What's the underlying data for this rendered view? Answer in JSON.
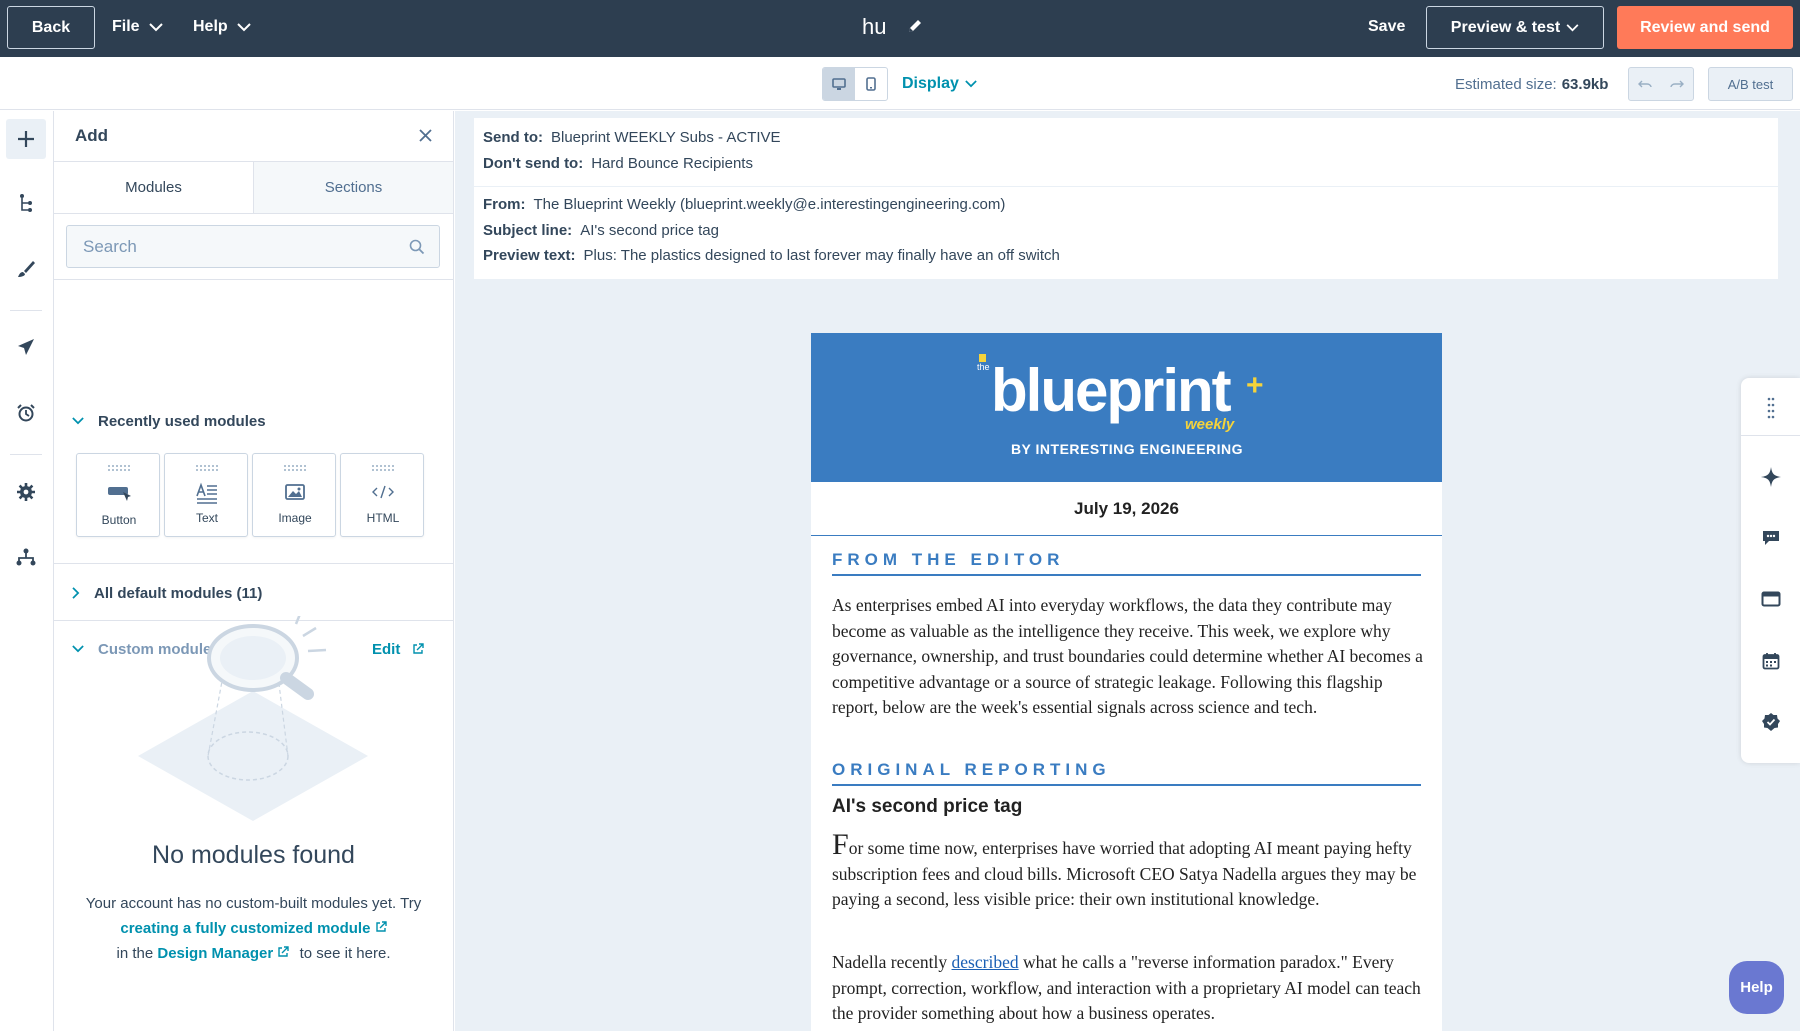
{
  "topbar": {
    "back_label": "Back",
    "file_label": "File",
    "help_label": "Help",
    "title": "hu",
    "save_label": "Save",
    "preview_label": "Preview & test",
    "review_label": "Review and send"
  },
  "toolbar": {
    "display_label": "Display",
    "estimated_size_label": "Estimated size:",
    "estimated_size_value": "63.9kb",
    "ab_test_label": "A/B test"
  },
  "panel": {
    "title": "Add",
    "tabs": [
      "Modules",
      "Sections"
    ],
    "search_placeholder": "Search",
    "recently_used_label": "Recently used modules",
    "modules": [
      {
        "label": "Button",
        "icon": "button-icon"
      },
      {
        "label": "Text",
        "icon": "text-icon"
      },
      {
        "label": "Image",
        "icon": "image-icon"
      },
      {
        "label": "HTML",
        "icon": "code-icon"
      }
    ],
    "all_default_label": "All default modules (11)",
    "custom_label": "Custom modules (0)",
    "edit_label": "Edit",
    "empty_title": "No modules found",
    "empty_text_1": "Your account has no custom-built modules yet. Try",
    "empty_link_1": "creating a fully customized module",
    "empty_text_2": "in the",
    "empty_link_2": "Design Manager",
    "empty_text_3": "to see it here."
  },
  "meta": {
    "send_to_label": "Send to:",
    "send_to_value": "Blueprint WEEKLY Subs - ACTIVE",
    "dont_send_label": "Don't send to:",
    "dont_send_value": "Hard Bounce Recipients",
    "from_label": "From:",
    "from_value": "The Blueprint Weekly (blueprint.weekly@e.interestingengineering.com)",
    "subject_label": "Subject line:",
    "subject_value": "AI's second price tag",
    "preview_text_label": "Preview text:",
    "preview_text_value": "Plus: The plastics designed to last forever may finally have an off switch"
  },
  "email": {
    "logo_small": "the",
    "logo_main": "blueprint",
    "logo_plus": "+",
    "logo_weekly": "weekly",
    "logo_byline": "BY INTERESTING ENGINEERING",
    "date": "July 19, 2026",
    "section_editor": "FROM THE EDITOR",
    "editor_text": "As enterprises embed AI into everyday workflows, the data they contribute may become as valuable as the intelligence they receive. This week, we explore why governance, ownership, and trust boundaries could determine whether AI becomes a competitive advantage or a source of strategic leakage. Following this flagship report, below are the week's essential signals across science and tech.",
    "section_reporting": "ORIGINAL REPORTING",
    "story_title": "AI's second price tag",
    "story_dropcap": "F",
    "story_p1": "or some time now, enterprises have worried that adopting AI meant paying hefty subscription fees and cloud bills. Microsoft CEO Satya Nadella argues they may be paying a second, less visible price: their own institutional knowledge.",
    "story_p2_a": "Nadella recently",
    "story_p2_link": "described",
    "story_p2_b": "what he calls a \"reverse information paradox.\" Every prompt, correction, workflow, and interaction with a proprietary AI model can teach the provider something about how a business operates."
  },
  "help_fab_label": "Help",
  "colors": {
    "topbar": "#2d3e50",
    "accent": "#ff7a59",
    "link": "#0091ae",
    "email_blue": "#3a7cc1",
    "logo_yellow": "#f5d33b"
  }
}
